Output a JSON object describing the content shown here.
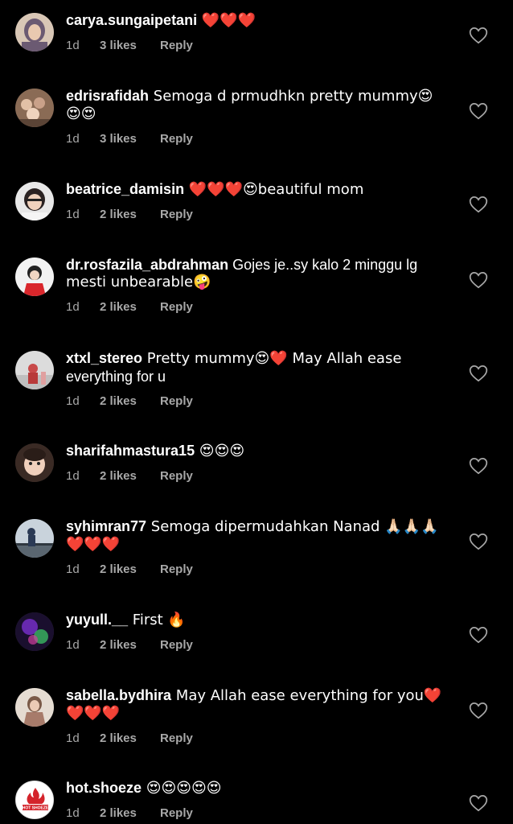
{
  "comments": [
    {
      "username": "carya.sungaipetani",
      "text": " ❤️❤️❤️",
      "second_line": "",
      "age": "1d",
      "likes": "3 likes",
      "reply": "Reply"
    },
    {
      "username": "edrisrafidah",
      "text": " Semoga d prmudhkn pretty mummy😍",
      "second_line": "😍😍",
      "age": "1d",
      "likes": "3 likes",
      "reply": "Reply"
    },
    {
      "username": "beatrice_damisin",
      "text": " ❤️❤️❤️😍beautiful mom",
      "second_line": "",
      "age": "1d",
      "likes": "2 likes",
      "reply": "Reply"
    },
    {
      "username": "dr.rosfazila_abdrahman",
      "text": " Gojes je..sy kalo 2 minggu lg",
      "second_line": "mesti unbearable🤪",
      "age": "1d",
      "likes": "2 likes",
      "reply": "Reply"
    },
    {
      "username": "xtxl_stereo",
      "text": " Pretty mummy😍❤️ May Allah ease",
      "second_line": "everything for u",
      "age": "1d",
      "likes": "2 likes",
      "reply": "Reply"
    },
    {
      "username": "sharifahmastura15",
      "text": " 😍😍😍",
      "second_line": "",
      "age": "1d",
      "likes": "2 likes",
      "reply": "Reply"
    },
    {
      "username": "syhimran77",
      "text": " Semoga dipermudahkan Nanad 🙏🏻🙏🏻🙏🏻",
      "second_line": "❤️❤️❤️",
      "age": "1d",
      "likes": "2 likes",
      "reply": "Reply"
    },
    {
      "username": "yuyull.__",
      "text": " First 🔥",
      "second_line": "",
      "age": "1d",
      "likes": "2 likes",
      "reply": "Reply"
    },
    {
      "username": "sabella.bydhira",
      "text": " May Allah ease everything for you❤️",
      "second_line": "❤️❤️❤️",
      "age": "1d",
      "likes": "2 likes",
      "reply": "Reply"
    },
    {
      "username": "hot.shoeze",
      "text": " 😍😍😍😍😍",
      "second_line": "",
      "age": "1d",
      "likes": "2 likes",
      "reply": "Reply"
    }
  ],
  "avatar_logo_text": "HOT SHOEZE",
  "colors": {
    "background": "#000000",
    "text": "#ffffff",
    "meta": "#a8a8a8",
    "heart_red": "#ed1c2e"
  },
  "icons": {
    "like": "heart-outline-icon"
  }
}
